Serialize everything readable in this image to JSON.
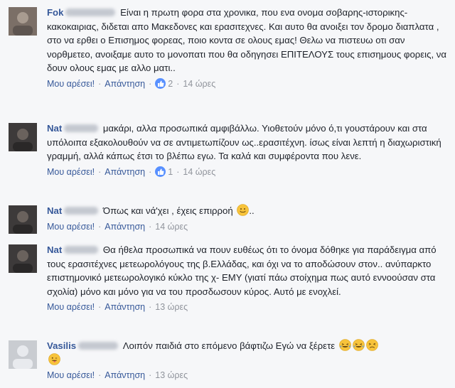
{
  "comments": [
    {
      "author": "Fok",
      "text": "Είναι η πρωτη φορα στα χρονικα, που ενα ονομα σοβαρης-ιστορικης-κακοκαιριας, διδεται απο Μακεδονες και ερασιτεχνες. Και αυτο θα ανοιξει τον δρομο διαπλατα , στο να ερθει ο Επισημος φορεας, ποιο κοντα σε ολους εμας! Θελω να πιστευω οτι σαν νορθμετεο, ανοιξαμε αυτο το μονοπατι που θα οδηγησει ΕΠΙΤΕΛΟΥΣ τους επισημους φορεις, να δουν ολους εμας με αλλο ματι..",
      "like_label": "Μου αρέσει!",
      "reply_label": "Απάντηση",
      "like_count": "2",
      "time": "14 ώρες"
    },
    {
      "author": "Nat",
      "text": "μακάρι, αλλα προσωπικά αμφιβάλλω. Υιοθετούν μόνο ό,τι γουστάρουν και στα υπόλοιπα εξακολουθούν να σε αντιμετωπίζουν ως..ερασιτέχνη. ίσως είναι λεπτή η διαχωριστική γραμμή, αλλά κάπως έτσι το βλέπω εγω. Τα καλά και συμφέροντα που λενε.",
      "like_label": "Μου αρέσει!",
      "reply_label": "Απάντηση",
      "like_count": "1",
      "time": "14 ώρες"
    },
    {
      "author": "Nat",
      "text": "Όπως και νά'χει , έχεις επιρροή",
      "suffix": "..",
      "like_label": "Μου αρέσει!",
      "reply_label": "Απάντηση",
      "time": "14 ώρες"
    },
    {
      "author": "Nat",
      "text": "Θα ήθελα προσωπικά να πουν ευθέως ότι το όνομα δόθηκε για παράδειγμα από τους ερασιτέχνες μετεωρολόγους της β.Ελλάδας, και όχι να το αποδώσουν στον.. ανύπαρκτο επιστημονικό μετεωρολογικό κύκλο της χ- ΕΜΥ (γιατί πάω στοίχημα πως αυτό εννοούσαν στα σχολία) μόνο και μόνο για να του προσδωσουν κύρος. Αυτό με ενοχλεί.",
      "like_label": "Μου αρέσει!",
      "reply_label": "Απάντηση",
      "time": "13 ώρες"
    },
    {
      "author": "Vasilis",
      "text": "Λοιπόν παιδιά στο επόμενο βάφτιζω Εγώ να ξέρετε",
      "like_label": "Μου αρέσει!",
      "reply_label": "Απάντηση",
      "time": "13 ώρες"
    }
  ],
  "colors": {
    "background": "#f6f7f9",
    "author": "#365899",
    "link": "#365899",
    "meta": "#90949c",
    "like_badge": "#5890ff",
    "emoji_face": "#f7c33b"
  },
  "icons": {
    "like": "thumbs-up-icon",
    "emoji_smile": "smile-emoji-icon",
    "emoji_laugh": "tears-of-joy-emoji-icon",
    "emoji_squint": "squint-emoji-icon",
    "emoji_tongue": "tongue-wink-emoji-icon"
  }
}
